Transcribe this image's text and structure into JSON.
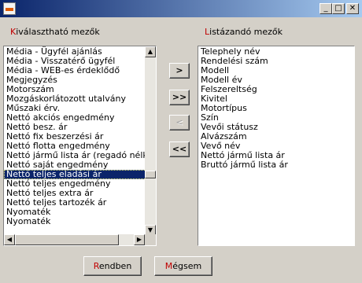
{
  "window": {
    "controls": {
      "minimize": "_",
      "maximize": "□",
      "close": "✕"
    }
  },
  "available": {
    "label_accel": "K",
    "label_rest": "iválasztható mezők",
    "items": [
      "Média - Ügyfél ajánlás",
      "Média - Visszatérő ügyfél",
      "Média - WEB-es érdeklődő",
      "Megjegyzés",
      "Motorszám",
      "Mozgáskorlátozott utalvány",
      "Műszaki érv.",
      "Nettó akciós engedmény",
      "Nettó besz. ár",
      "Nettó fix beszerzési ár",
      "Nettó flotta engedmény",
      "Nettó jármű lista ár (regadó nélkül)",
      "Nettó saját engedmény",
      "Nettó teljes eladási ár",
      "Nettó teljes engedmény",
      "Nettó teljes extra ár",
      "Nettó teljes tartozék ár",
      "Nyomaték",
      "Nyomaték"
    ],
    "selected": "Nettó teljes eladási ár"
  },
  "listed": {
    "label_accel": "L",
    "label_rest": "istázandó mezők",
    "items": [
      "Telephely név",
      "Rendelési szám",
      "Modell",
      "Modell év",
      "Felszereltség",
      "Kivitel",
      "Motortípus",
      "Szín",
      "Vevői státusz",
      "Alvázszám",
      "Vevő név",
      "Nettó jármű lista ár",
      "Bruttó jármű lista ár"
    ]
  },
  "move_buttons": {
    "add_one": ">",
    "add_all": ">>",
    "remove_one": "<",
    "remove_all": "<<"
  },
  "actions": {
    "ok_accel": "R",
    "ok_rest": "endben",
    "cancel_accel": "M",
    "cancel_rest": "égsem"
  },
  "colors": {
    "title_start": "#0a246a",
    "title_end": "#a6caf0",
    "selection": "#0a246a",
    "accelerator": "#c00000",
    "face": "#d4d0c8"
  }
}
